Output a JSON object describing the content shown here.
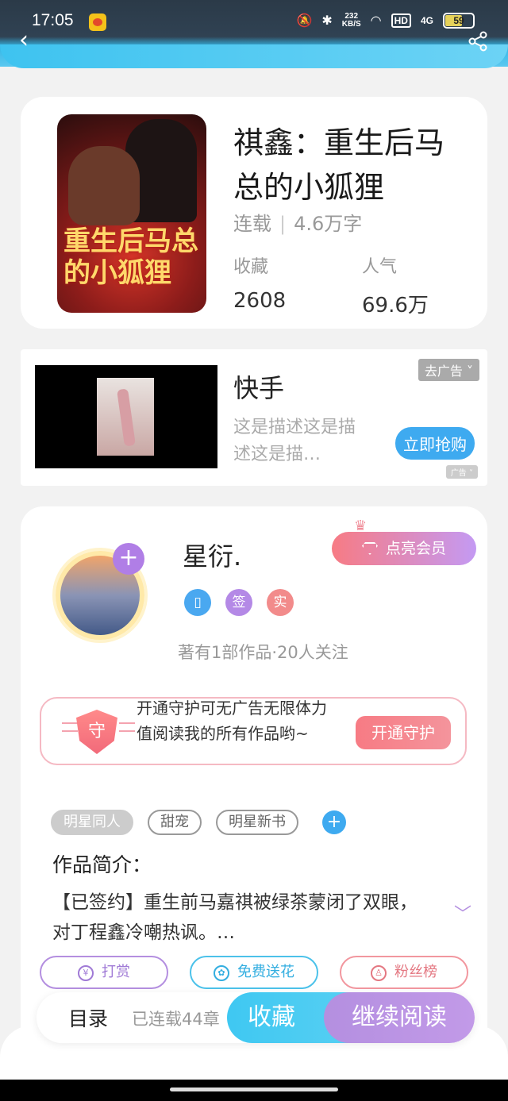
{
  "status_bar": {
    "time": "17:05",
    "net_speed_value": "232",
    "net_speed_unit": "KB/S",
    "hd": "HD",
    "network": "4G",
    "battery": "59"
  },
  "header": {
    "back": "‹"
  },
  "book": {
    "cover_text": "重生后马总的小狐狸",
    "title": "祺鑫：重生后马总的小狐狸",
    "status": "连载",
    "word_count": "4.6万字",
    "stats": [
      {
        "label": "收藏",
        "value": "2608"
      },
      {
        "label": "人气",
        "value": "69.6万"
      }
    ]
  },
  "ad": {
    "title": "快手",
    "description": "这是描述这是描述这是描…",
    "remove_label": "去广告",
    "cta_label": "立即抢购",
    "tag": "广告"
  },
  "author": {
    "name": "星衍.",
    "vip_label": "点亮会员",
    "badges": [
      "",
      "签",
      "实"
    ],
    "stats": "著有1部作品·20人关注",
    "guard_text": "开通守护可无广告无限体力值阅读我的所有作品哟~",
    "guard_icon": "守",
    "guard_button": "开通守护"
  },
  "tags": [
    "明星同人",
    "甜宠",
    "明星新书"
  ],
  "intro": {
    "title": "作品简介：",
    "text": "【已签约】重生前马嘉祺被绿茶蒙闭了双眼，对丁程鑫冷嘲热讽。…"
  },
  "actions": [
    {
      "label": "打赏",
      "icon": "¥"
    },
    {
      "label": "免费送花",
      "icon": "✿"
    },
    {
      "label": "粉丝榜",
      "icon": "♙"
    }
  ],
  "bottom": {
    "toc": "目录",
    "toc_sub": "已连载44章",
    "favorite": "收藏",
    "continue": "继续阅读"
  },
  "colors": {
    "accent_blue": "#3fc8f2",
    "accent_purple": "#b48fe0",
    "accent_pink": "#f77b84"
  }
}
